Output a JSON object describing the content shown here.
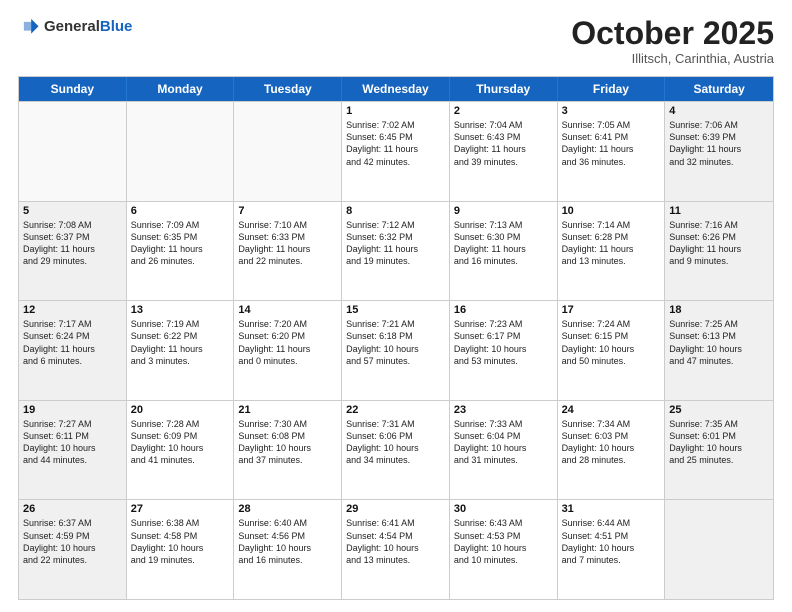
{
  "header": {
    "logo_general": "General",
    "logo_blue": "Blue",
    "month": "October 2025",
    "location": "Illitsch, Carinthia, Austria"
  },
  "days_of_week": [
    "Sunday",
    "Monday",
    "Tuesday",
    "Wednesday",
    "Thursday",
    "Friday",
    "Saturday"
  ],
  "weeks": [
    [
      {
        "day": "",
        "info": "",
        "empty": true
      },
      {
        "day": "",
        "info": "",
        "empty": true
      },
      {
        "day": "",
        "info": "",
        "empty": true
      },
      {
        "day": "1",
        "info": "Sunrise: 7:02 AM\nSunset: 6:45 PM\nDaylight: 11 hours\nand 42 minutes.",
        "empty": false
      },
      {
        "day": "2",
        "info": "Sunrise: 7:04 AM\nSunset: 6:43 PM\nDaylight: 11 hours\nand 39 minutes.",
        "empty": false
      },
      {
        "day": "3",
        "info": "Sunrise: 7:05 AM\nSunset: 6:41 PM\nDaylight: 11 hours\nand 36 minutes.",
        "empty": false
      },
      {
        "day": "4",
        "info": "Sunrise: 7:06 AM\nSunset: 6:39 PM\nDaylight: 11 hours\nand 32 minutes.",
        "empty": false,
        "shaded": true
      }
    ],
    [
      {
        "day": "5",
        "info": "Sunrise: 7:08 AM\nSunset: 6:37 PM\nDaylight: 11 hours\nand 29 minutes.",
        "empty": false,
        "shaded": true
      },
      {
        "day": "6",
        "info": "Sunrise: 7:09 AM\nSunset: 6:35 PM\nDaylight: 11 hours\nand 26 minutes.",
        "empty": false
      },
      {
        "day": "7",
        "info": "Sunrise: 7:10 AM\nSunset: 6:33 PM\nDaylight: 11 hours\nand 22 minutes.",
        "empty": false
      },
      {
        "day": "8",
        "info": "Sunrise: 7:12 AM\nSunset: 6:32 PM\nDaylight: 11 hours\nand 19 minutes.",
        "empty": false
      },
      {
        "day": "9",
        "info": "Sunrise: 7:13 AM\nSunset: 6:30 PM\nDaylight: 11 hours\nand 16 minutes.",
        "empty": false
      },
      {
        "day": "10",
        "info": "Sunrise: 7:14 AM\nSunset: 6:28 PM\nDaylight: 11 hours\nand 13 minutes.",
        "empty": false
      },
      {
        "day": "11",
        "info": "Sunrise: 7:16 AM\nSunset: 6:26 PM\nDaylight: 11 hours\nand 9 minutes.",
        "empty": false,
        "shaded": true
      }
    ],
    [
      {
        "day": "12",
        "info": "Sunrise: 7:17 AM\nSunset: 6:24 PM\nDaylight: 11 hours\nand 6 minutes.",
        "empty": false,
        "shaded": true
      },
      {
        "day": "13",
        "info": "Sunrise: 7:19 AM\nSunset: 6:22 PM\nDaylight: 11 hours\nand 3 minutes.",
        "empty": false
      },
      {
        "day": "14",
        "info": "Sunrise: 7:20 AM\nSunset: 6:20 PM\nDaylight: 11 hours\nand 0 minutes.",
        "empty": false
      },
      {
        "day": "15",
        "info": "Sunrise: 7:21 AM\nSunset: 6:18 PM\nDaylight: 10 hours\nand 57 minutes.",
        "empty": false
      },
      {
        "day": "16",
        "info": "Sunrise: 7:23 AM\nSunset: 6:17 PM\nDaylight: 10 hours\nand 53 minutes.",
        "empty": false
      },
      {
        "day": "17",
        "info": "Sunrise: 7:24 AM\nSunset: 6:15 PM\nDaylight: 10 hours\nand 50 minutes.",
        "empty": false
      },
      {
        "day": "18",
        "info": "Sunrise: 7:25 AM\nSunset: 6:13 PM\nDaylight: 10 hours\nand 47 minutes.",
        "empty": false,
        "shaded": true
      }
    ],
    [
      {
        "day": "19",
        "info": "Sunrise: 7:27 AM\nSunset: 6:11 PM\nDaylight: 10 hours\nand 44 minutes.",
        "empty": false,
        "shaded": true
      },
      {
        "day": "20",
        "info": "Sunrise: 7:28 AM\nSunset: 6:09 PM\nDaylight: 10 hours\nand 41 minutes.",
        "empty": false
      },
      {
        "day": "21",
        "info": "Sunrise: 7:30 AM\nSunset: 6:08 PM\nDaylight: 10 hours\nand 37 minutes.",
        "empty": false
      },
      {
        "day": "22",
        "info": "Sunrise: 7:31 AM\nSunset: 6:06 PM\nDaylight: 10 hours\nand 34 minutes.",
        "empty": false
      },
      {
        "day": "23",
        "info": "Sunrise: 7:33 AM\nSunset: 6:04 PM\nDaylight: 10 hours\nand 31 minutes.",
        "empty": false
      },
      {
        "day": "24",
        "info": "Sunrise: 7:34 AM\nSunset: 6:03 PM\nDaylight: 10 hours\nand 28 minutes.",
        "empty": false
      },
      {
        "day": "25",
        "info": "Sunrise: 7:35 AM\nSunset: 6:01 PM\nDaylight: 10 hours\nand 25 minutes.",
        "empty": false,
        "shaded": true
      }
    ],
    [
      {
        "day": "26",
        "info": "Sunrise: 6:37 AM\nSunset: 4:59 PM\nDaylight: 10 hours\nand 22 minutes.",
        "empty": false,
        "shaded": true
      },
      {
        "day": "27",
        "info": "Sunrise: 6:38 AM\nSunset: 4:58 PM\nDaylight: 10 hours\nand 19 minutes.",
        "empty": false
      },
      {
        "day": "28",
        "info": "Sunrise: 6:40 AM\nSunset: 4:56 PM\nDaylight: 10 hours\nand 16 minutes.",
        "empty": false
      },
      {
        "day": "29",
        "info": "Sunrise: 6:41 AM\nSunset: 4:54 PM\nDaylight: 10 hours\nand 13 minutes.",
        "empty": false
      },
      {
        "day": "30",
        "info": "Sunrise: 6:43 AM\nSunset: 4:53 PM\nDaylight: 10 hours\nand 10 minutes.",
        "empty": false
      },
      {
        "day": "31",
        "info": "Sunrise: 6:44 AM\nSunset: 4:51 PM\nDaylight: 10 hours\nand 7 minutes.",
        "empty": false
      },
      {
        "day": "",
        "info": "",
        "empty": true,
        "shaded": true
      }
    ]
  ]
}
